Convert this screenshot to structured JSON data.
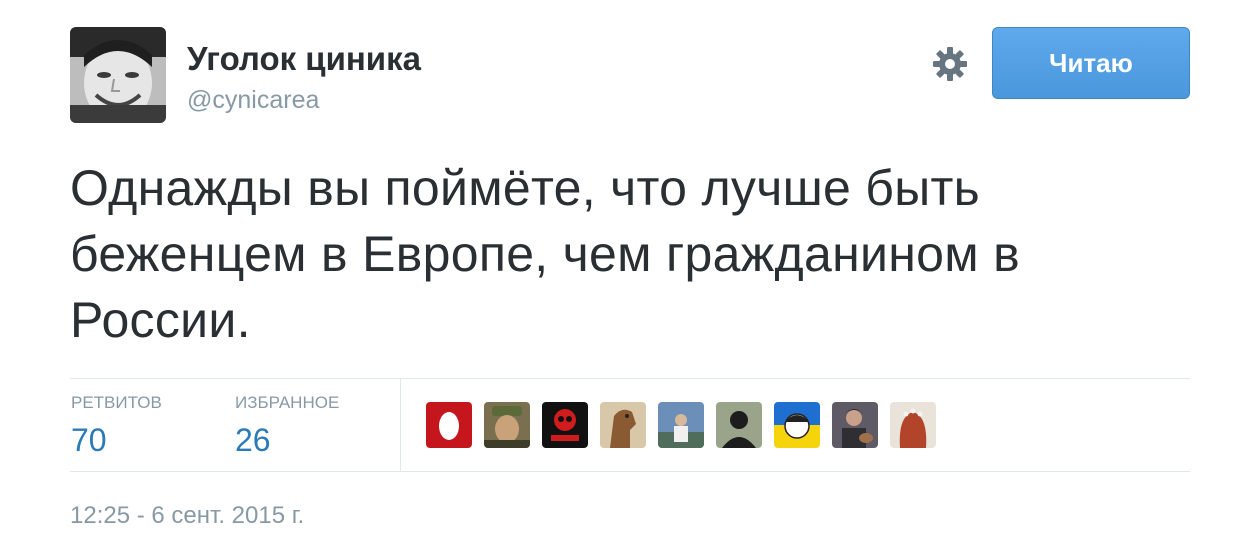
{
  "author": {
    "name": "Уголок циника",
    "handle": "@cynicarea",
    "avatar_icon": "smiling-man-avatar"
  },
  "header": {
    "settings_icon": "gear-icon",
    "follow_label": "Читаю"
  },
  "tweet": {
    "text": "Однажды вы поймёте, что лучше быть беженцем в Европе, чем гражданином в России."
  },
  "stats": {
    "retweets_label": "РЕТВИТОВ",
    "retweets_count": "70",
    "favorites_label": "ИЗБРАННОЕ",
    "favorites_count": "26"
  },
  "favorited_by": [
    {
      "icon": "red-egg-avatar"
    },
    {
      "icon": "man-with-cap-avatar"
    },
    {
      "icon": "red-skull-band-avatar"
    },
    {
      "icon": "horse-avatar"
    },
    {
      "icon": "person-outdoors-avatar"
    },
    {
      "icon": "silhouette-avatar"
    },
    {
      "icon": "ukraine-cartoon-avatar"
    },
    {
      "icon": "man-with-guitar-avatar"
    },
    {
      "icon": "girl-with-flowers-avatar"
    }
  ],
  "timestamp": "12:25 - 6 сент. 2015 г.",
  "colors": {
    "link": "#2b7bb9",
    "muted": "#8899a6",
    "button": "#4a97dd",
    "divider": "#e1e8ed"
  }
}
